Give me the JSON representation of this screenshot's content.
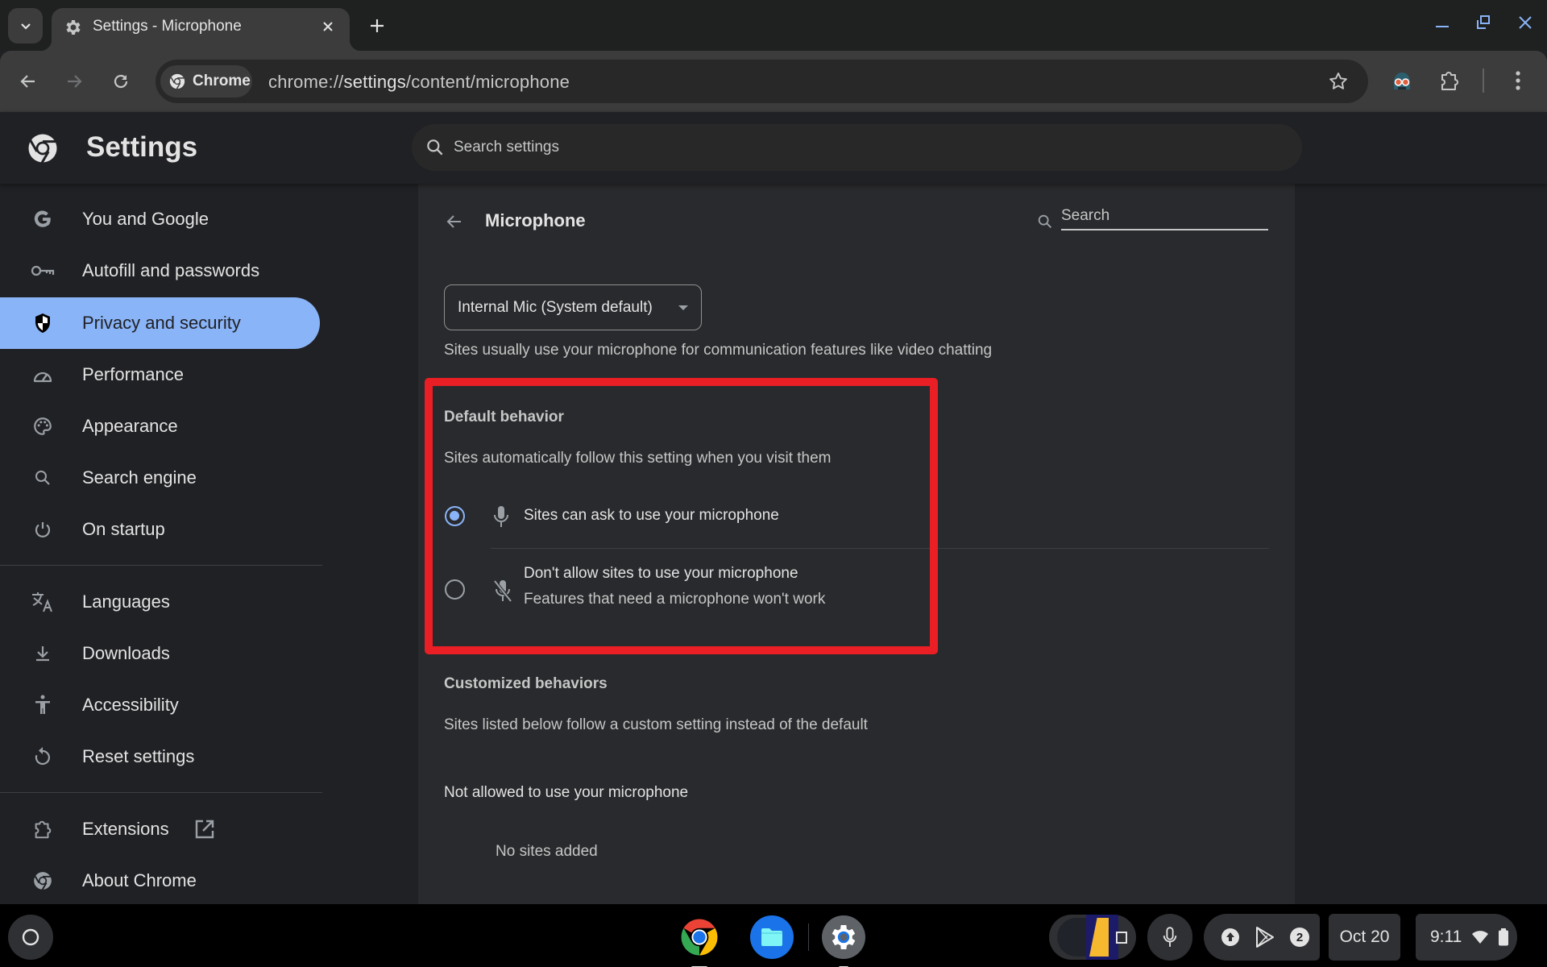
{
  "browser": {
    "tab": {
      "title": "Settings - Microphone",
      "icon": "gear-icon"
    },
    "omnibox": {
      "chip_label": "Chrome",
      "url_scheme": "chrome://",
      "url_host": "settings",
      "url_path": "/content/microphone"
    }
  },
  "settings": {
    "title": "Settings",
    "search_placeholder": "Search settings"
  },
  "sidebar": {
    "items": [
      {
        "label": "You and Google",
        "icon": "google-g-icon",
        "active": false
      },
      {
        "label": "Autofill and passwords",
        "icon": "key-icon",
        "active": false
      },
      {
        "label": "Privacy and security",
        "icon": "shield-icon",
        "active": true
      },
      {
        "label": "Performance",
        "icon": "speedometer-icon",
        "active": false
      },
      {
        "label": "Appearance",
        "icon": "palette-icon",
        "active": false
      },
      {
        "label": "Search engine",
        "icon": "search-icon",
        "active": false
      },
      {
        "label": "On startup",
        "icon": "power-icon",
        "active": false
      },
      {
        "label": "Languages",
        "icon": "translate-icon",
        "active": false
      },
      {
        "label": "Downloads",
        "icon": "download-icon",
        "active": false
      },
      {
        "label": "Accessibility",
        "icon": "accessibility-icon",
        "active": false
      },
      {
        "label": "Reset settings",
        "icon": "reset-icon",
        "active": false
      },
      {
        "label": "Extensions",
        "icon": "extension-icon",
        "active": false,
        "external": true
      },
      {
        "label": "About Chrome",
        "icon": "chrome-icon",
        "active": false
      }
    ]
  },
  "page": {
    "title": "Microphone",
    "search_placeholder": "Search",
    "mic_select": {
      "value": "Internal Mic (System default)"
    },
    "mic_description": "Sites usually use your microphone for communication features like video chatting",
    "default_behavior": {
      "title": "Default behavior",
      "description": "Sites automatically follow this setting when you visit them",
      "options": [
        {
          "label": "Sites can ask to use your microphone",
          "sublabel": "",
          "icon": "microphone-icon",
          "checked": true
        },
        {
          "label": "Don't allow sites to use your microphone",
          "sublabel": "Features that need a microphone won't work",
          "icon": "microphone-off-icon",
          "checked": false
        }
      ]
    },
    "customized": {
      "title": "Customized behaviors",
      "description": "Sites listed below follow a custom setting instead of the default",
      "not_allowed_title": "Not allowed to use your microphone",
      "empty_text": "No sites added"
    },
    "highlight_color": "#ea1e25"
  },
  "shelf": {
    "apps": [
      "Chrome",
      "Files",
      "Settings"
    ],
    "notification_count": "2",
    "date": "Oct 20",
    "time": "9:11"
  },
  "colors": {
    "accent": "#8ab4f8",
    "background": "#202124",
    "card": "#292a2d"
  }
}
